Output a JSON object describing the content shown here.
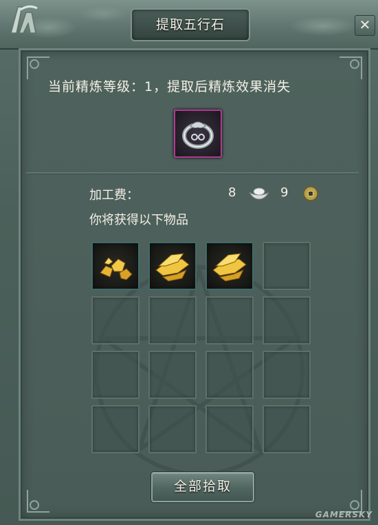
{
  "window": {
    "title": "提取五行石",
    "close_label": "✕"
  },
  "refine_info": "当前精炼等级：1，提取后精炼效果消失",
  "fee": {
    "label": "加工费：",
    "silver": "8",
    "gold": "9"
  },
  "rewards_label": "你将获得以下物品",
  "rewards": {
    "filled_slots": 3,
    "total_slots": 16,
    "items": [
      "gold-ore-icon",
      "gold-ingot-icon",
      "gold-ingot-icon"
    ]
  },
  "collect_all_label": "全部拾取",
  "watermark": "GAMERSKY",
  "colors": {
    "rare_item_border": "#b23a92",
    "panel_bg": "#4f625d",
    "text": "#f3f0e6"
  }
}
